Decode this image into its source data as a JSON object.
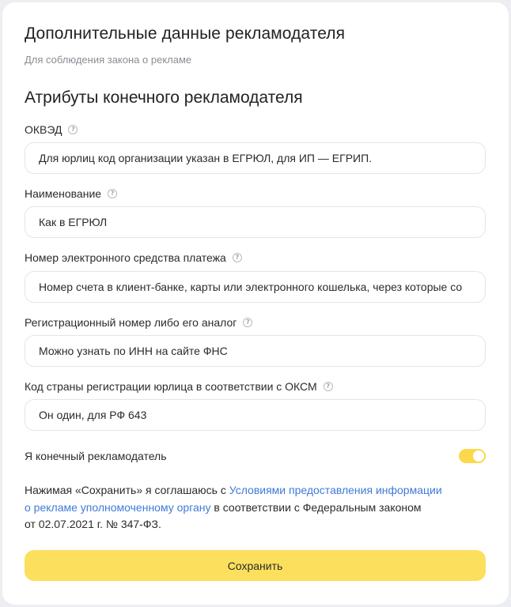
{
  "header": {
    "title": "Дополнительные данные рекламодателя",
    "subtitle": "Для соблюдения закона о рекламе"
  },
  "section": {
    "title": "Атрибуты конечного рекламодателя"
  },
  "fields": [
    {
      "label": "ОКВЭД",
      "help_icon": "question-circle-icon",
      "value": "",
      "placeholder": "Для юрлиц код организации указан в ЕГРЮЛ, для ИП — ЕГРИП."
    },
    {
      "label": "Наименование",
      "help_icon": "question-circle-icon",
      "value": "",
      "placeholder": "Как в ЕГРЮЛ"
    },
    {
      "label": "Номер электронного средства платежа",
      "help_icon": "question-circle-icon",
      "value": "",
      "placeholder": "Номер счета в клиент-банке, карты или электронного кошелька, через которые со"
    },
    {
      "label": "Регистрационный номер либо его аналог",
      "help_icon": "question-circle-icon",
      "value": "",
      "placeholder": "Можно узнать по ИНН на сайте ФНС"
    },
    {
      "label": "Код страны регистрации юрлица в соответствии с ОКСМ",
      "help_icon": "question-circle-icon",
      "value": "",
      "placeholder": "Он один, для РФ 643"
    }
  ],
  "final_advertiser": {
    "label": "Я конечный рекламодатель",
    "enabled": true
  },
  "agreement": {
    "prefix": "Нажимая «Сохранить» я соглашаюсь с ",
    "link_text_line1": "Условиями предоставления информации",
    "link_text_line2": "о рекламе уполномоченному органу",
    "suffix_line2": " в соответствии с Федеральным законом",
    "suffix_line3": "от 02.07.2021 г. № 347-ФЗ."
  },
  "actions": {
    "save_label": "Сохранить"
  },
  "colors": {
    "accent_yellow": "#fcdf5c",
    "link_blue": "#3f7ad9",
    "toggle_on": "#fcd84c"
  }
}
